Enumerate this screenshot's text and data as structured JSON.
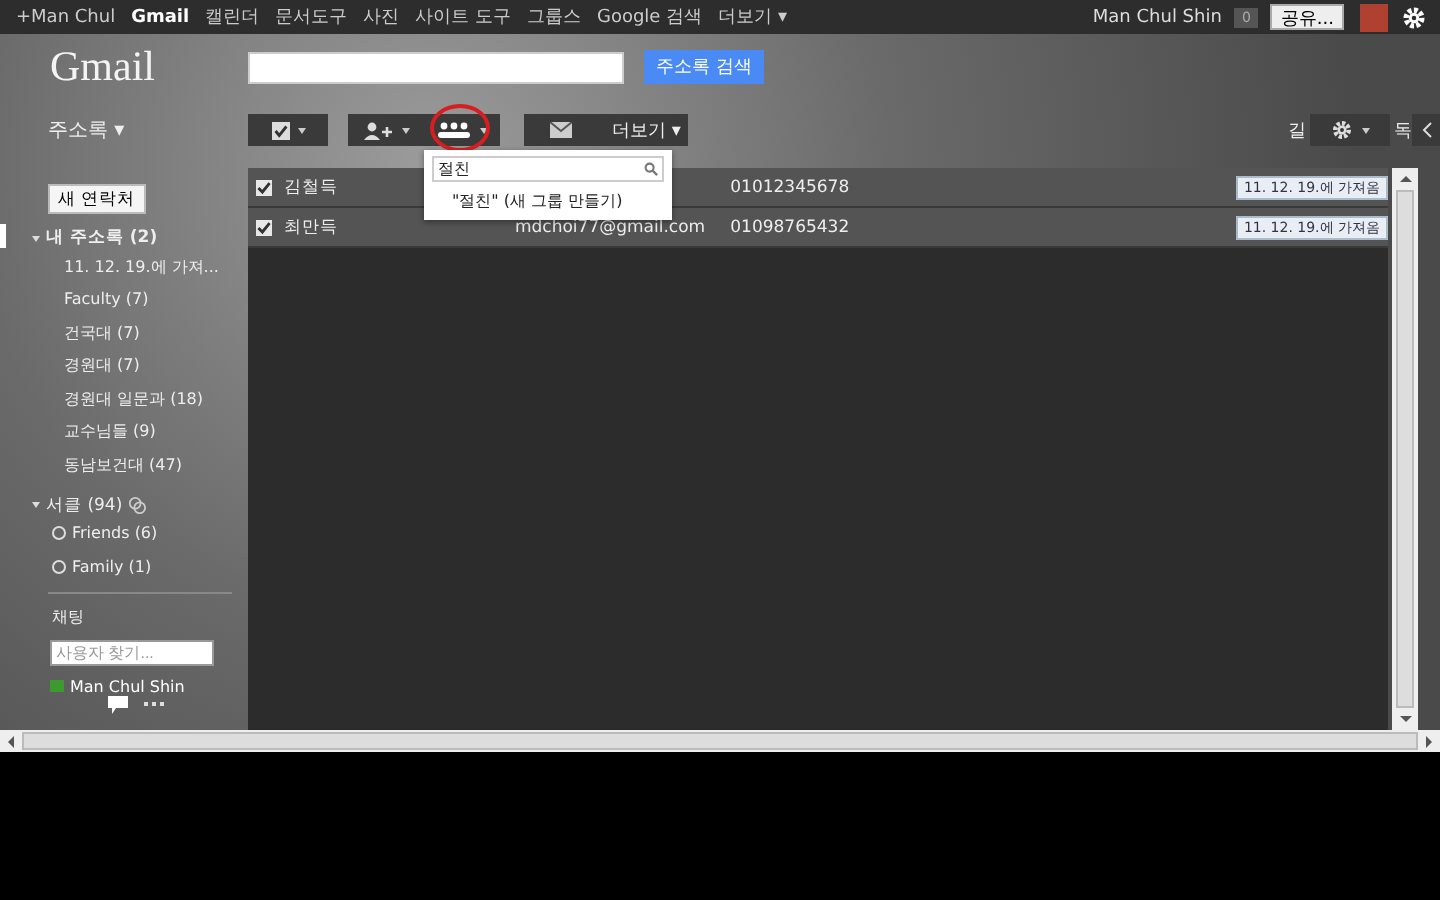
{
  "top_nav": {
    "items": [
      {
        "label": "+Man Chul",
        "selected": false
      },
      {
        "label": "Gmail",
        "selected": true
      },
      {
        "label": "캘린더",
        "selected": false
      },
      {
        "label": "문서도구",
        "selected": false
      },
      {
        "label": "사진",
        "selected": false
      },
      {
        "label": "사이트 도구",
        "selected": false
      },
      {
        "label": "그룹스",
        "selected": false
      },
      {
        "label": "Google 검색",
        "selected": false
      },
      {
        "label": "더보기 ▾",
        "selected": false
      }
    ],
    "user_name": "Man Chul Shin",
    "notification_count": "0",
    "share_button": "공유..."
  },
  "header": {
    "logo": "Gmail",
    "search_button": "주소록 검색"
  },
  "toolbar": {
    "section_menu": "주소록 ▾",
    "more_button": "더보기 ▾",
    "right_fragments": [
      "길",
      "독"
    ]
  },
  "group_dropdown": {
    "search_value": "절친",
    "option": "\"절친\" (새 그룹 만들기)"
  },
  "sidebar": {
    "new_contact_button": "새 연락처",
    "groups": [
      {
        "label": "내 주소록 (2)",
        "expanded": true,
        "selected": true,
        "children": [
          {
            "label": "11. 12. 19.에 가져..."
          },
          {
            "label": "Faculty (7)"
          },
          {
            "label": "건국대 (7)"
          },
          {
            "label": "경원대 (7)"
          },
          {
            "label": "경원대 일문과 (18)"
          },
          {
            "label": "교수님들 (9)"
          },
          {
            "label": "동남보건대 (47)"
          }
        ]
      },
      {
        "label": "서클 (94)",
        "expanded": true,
        "selected": false,
        "children": [
          {
            "label": "Friends (6)"
          },
          {
            "label": "Family (1)"
          }
        ]
      }
    ],
    "chat_title": "채팅",
    "chat_search_placeholder": "사용자 찾기...",
    "chat_users": [
      {
        "name": "Man Chul Shin",
        "color": "#3c9a2e"
      }
    ]
  },
  "contacts": [
    {
      "name": "김철득",
      "phone": "01012345678",
      "tag": "11. 12. 19.에 가져옴",
      "checked": true
    },
    {
      "name": "최만득",
      "email": "mdchoi77@gmail.com",
      "phone": "01098765432",
      "tag": "11. 12. 19.에 가져옴",
      "checked": true
    }
  ]
}
